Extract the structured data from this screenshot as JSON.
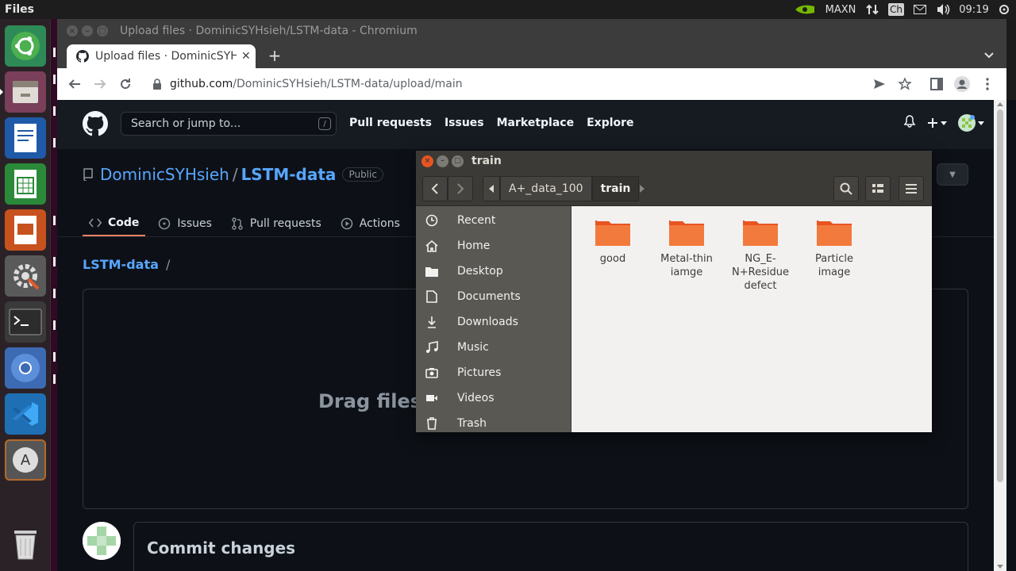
{
  "top_panel": {
    "app_name": "Files",
    "nvidia_mode": "MAXN",
    "keyboard": "Ch",
    "time": "09:19"
  },
  "launcher": {
    "items": [
      "ubuntu-logo-icon",
      "file-manager-icon",
      "writer-icon",
      "calc-icon",
      "impress-icon",
      "system-settings-icon",
      "terminal-icon",
      "chromium-icon",
      "vscode-icon",
      "software-updater-icon",
      "trash-icon"
    ]
  },
  "chromium": {
    "window_title": "Upload files · DominicSYHsieh/LSTM-data - Chromium",
    "tab_title": "Upload files · DominicSYHsieh/LSTM-data",
    "url_host": "github.com",
    "url_path": "/DominicSYHsieh/LSTM-data/upload/main"
  },
  "github": {
    "search_placeholder": "Search or jump to...",
    "search_key": "/",
    "nav": [
      "Pull requests",
      "Issues",
      "Marketplace",
      "Explore"
    ],
    "owner": "DominicSYHsieh",
    "repo": "LSTM-data",
    "visibility": "Public",
    "repo_tabs": [
      "Code",
      "Issues",
      "Pull requests",
      "Actions"
    ],
    "breadcrumb_repo": "LSTM-data",
    "breadcrumb_sep": "/",
    "dropzone_text": "Drag files h",
    "commit_title": "Commit changes"
  },
  "files_window": {
    "title": "train",
    "path": [
      "A+_data_100",
      "train"
    ],
    "sidebar": [
      "Recent",
      "Home",
      "Desktop",
      "Documents",
      "Downloads",
      "Music",
      "Pictures",
      "Videos",
      "Trash"
    ],
    "folders": [
      "good",
      "Metal-thin iamge",
      "NG_E-N+Residue defect",
      "Particle image"
    ]
  }
}
